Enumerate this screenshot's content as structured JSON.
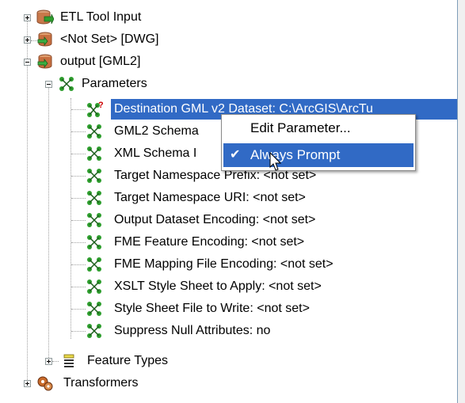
{
  "tree": {
    "root_items": [
      {
        "label": "ETL Tool Input",
        "icon": "etl-tool-input-icon",
        "expander": "plus"
      },
      {
        "label": "<Not Set> [DWG]",
        "icon": "dataset-writer-icon",
        "expander": "plus"
      },
      {
        "label": "output [GML2]",
        "icon": "dataset-writer-icon",
        "expander": "minus"
      }
    ],
    "parameters_label": "Parameters",
    "parameters": [
      {
        "label": "Destination GML v2 Dataset: C:\\ArcGIS\\ArcTu",
        "selected": true,
        "required": true
      },
      {
        "label": "GML2 Schema"
      },
      {
        "label": "XML Schema I"
      },
      {
        "label": "Target Namespace Prefix: <not set>"
      },
      {
        "label": "Target Namespace URI: <not set>"
      },
      {
        "label": "Output Dataset Encoding: <not set>"
      },
      {
        "label": "FME Feature Encoding: <not set>"
      },
      {
        "label": "FME Mapping File Encoding: <not set>"
      },
      {
        "label": "XSLT Style Sheet to Apply: <not set>"
      },
      {
        "label": "Style Sheet File to Write: <not set>"
      },
      {
        "label": "Suppress Null Attributes: no"
      }
    ],
    "feature_types_label": "Feature Types",
    "transformers_label": "Transformers"
  },
  "context_menu": {
    "edit_label": "Edit Parameter...",
    "always_prompt_label": "Always Prompt",
    "always_prompt_checked": true
  },
  "colors": {
    "selection": "#316ac5",
    "param_icon_green": "#2e9e2e",
    "required_red": "#cc0000"
  }
}
